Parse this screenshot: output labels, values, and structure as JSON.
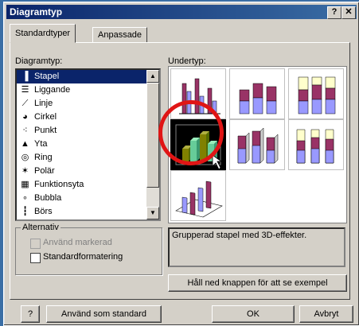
{
  "window": {
    "title": "Diagramtyp",
    "help_glyph": "?",
    "close_glyph": "✕"
  },
  "tabs": [
    {
      "label": "Standardtyper"
    },
    {
      "label": "Anpassade"
    }
  ],
  "chart_type_label": "Diagramtyp:",
  "chart_types": [
    {
      "label": "Stapel",
      "icon": "bar-chart-icon",
      "glyph": "▐"
    },
    {
      "label": "Liggande",
      "icon": "horizontal-bar-icon",
      "glyph": "☰"
    },
    {
      "label": "Linje",
      "icon": "line-chart-icon",
      "glyph": "⟋"
    },
    {
      "label": "Cirkel",
      "icon": "pie-chart-icon",
      "glyph": "◕"
    },
    {
      "label": "Punkt",
      "icon": "scatter-icon",
      "glyph": "⁖"
    },
    {
      "label": "Yta",
      "icon": "area-chart-icon",
      "glyph": "▲"
    },
    {
      "label": "Ring",
      "icon": "doughnut-icon",
      "glyph": "◎"
    },
    {
      "label": "Polär",
      "icon": "radar-icon",
      "glyph": "✶"
    },
    {
      "label": "Funktionsyta",
      "icon": "surface-icon",
      "glyph": "▦"
    },
    {
      "label": "Bubbla",
      "icon": "bubble-icon",
      "glyph": "∘"
    },
    {
      "label": "Börs",
      "icon": "stock-icon",
      "glyph": "┇"
    }
  ],
  "selected_type_index": 0,
  "subtype_label": "Undertyp:",
  "selected_subtype_index": 3,
  "options": {
    "group_title": "Alternativ",
    "apply_default": "Använd markerad",
    "default_formatting": "Standardformatering"
  },
  "description": "Grupperad stapel med 3D-effekter.",
  "preview_button": "Håll ned knappen för att se exempel",
  "footer": {
    "help_glyph": "?",
    "set_default": "Använd som standard",
    "ok": "OK",
    "cancel": "Avbryt"
  },
  "colors": {
    "purple": "#993366",
    "lavender": "#9999ff",
    "cream": "#ffffcc",
    "olive": "#808000",
    "teal": "#66cc99"
  }
}
